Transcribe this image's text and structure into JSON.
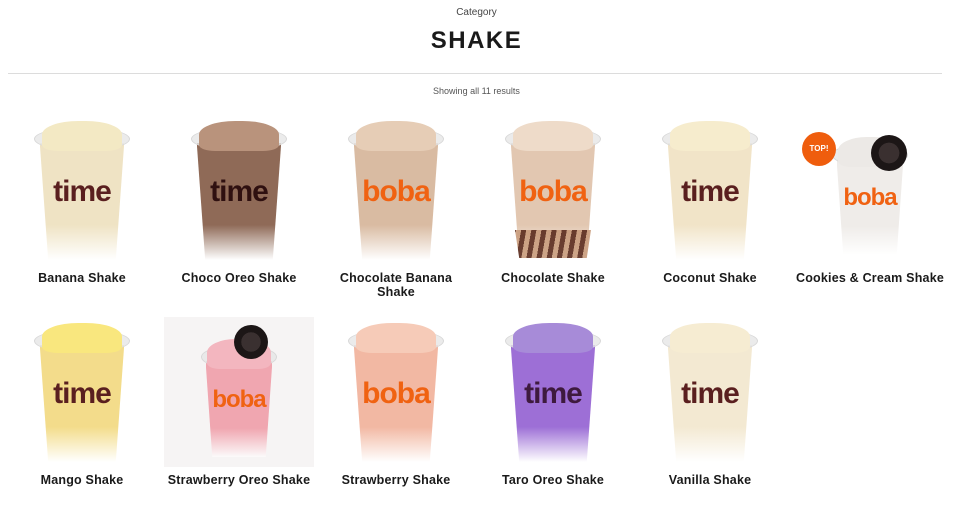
{
  "header": {
    "eyebrow": "Category",
    "title": "SHAKE",
    "result_count": "Showing all 11 results"
  },
  "brand": {
    "time": "time",
    "boba": "boba"
  },
  "products": [
    {
      "name": "Banana Shake",
      "brand": "time",
      "top_color": "#f3e9c4",
      "body_color": "#efe3c4",
      "brand_color": "#5a1f1f"
    },
    {
      "name": "Choco Oreo Shake",
      "brand": "time",
      "top_color": "#b9937c",
      "body_color": "#8f6a57",
      "brand_color": "#2f1010"
    },
    {
      "name": "Chocolate Banana Shake",
      "brand": "boba",
      "top_color": "#e6cdb6",
      "body_color": "#d9bba2",
      "brand_color": "#f06212"
    },
    {
      "name": "Chocolate Shake",
      "brand": "boba",
      "top_color": "#eedbc9",
      "body_color": "#e2c7b1",
      "brand_color": "#f06212"
    },
    {
      "name": "Coconut Shake",
      "brand": "time",
      "top_color": "#f6eccd",
      "body_color": "#f1e4c8",
      "brand_color": "#5a1f1f"
    },
    {
      "name": "Cookies & Cream Shake",
      "brand": "boba",
      "top_color": "#ece9e6",
      "body_color": "#efece9",
      "brand_color": "#f06212",
      "badge": "TOP!"
    },
    {
      "name": "Mango Shake",
      "brand": "time",
      "top_color": "#f9e77e",
      "body_color": "#f3dc8b",
      "brand_color": "#5a1f1f"
    },
    {
      "name": "Strawberry Oreo Shake",
      "brand": "boba",
      "top_color": "#f3b6bf",
      "body_color": "#f0a6b0",
      "brand_color": "#f06212"
    },
    {
      "name": "Strawberry Shake",
      "brand": "boba",
      "top_color": "#f6cbb8",
      "body_color": "#f2b8a3",
      "brand_color": "#f06212"
    },
    {
      "name": "Taro Oreo Shake",
      "brand": "time",
      "top_color": "#a78bd8",
      "body_color": "#9d6fd6",
      "brand_color": "#3e1a3e"
    },
    {
      "name": "Vanilla Shake",
      "brand": "time",
      "top_color": "#f6ecd2",
      "body_color": "#f3e9d2",
      "brand_color": "#5a1f1f"
    }
  ]
}
